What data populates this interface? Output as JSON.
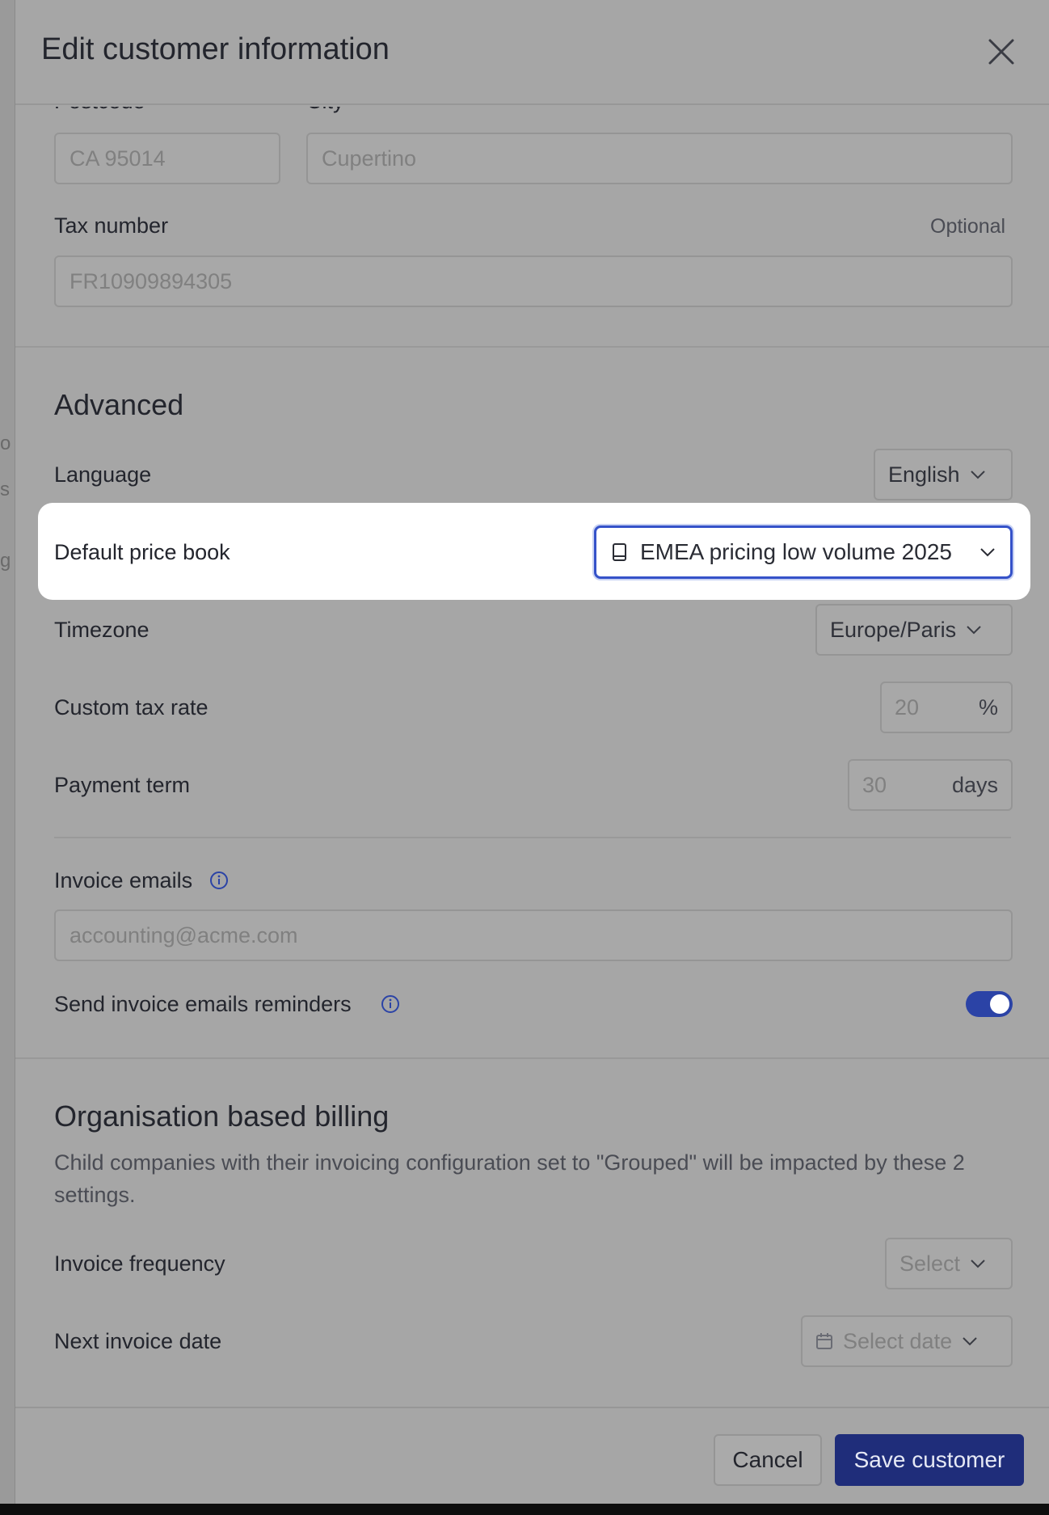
{
  "header": {
    "title": "Edit customer information"
  },
  "address": {
    "postcode_label": "Postcode",
    "city_label": "City",
    "postcode_value": "CA 95014",
    "city_value": "Cupertino"
  },
  "tax": {
    "label": "Tax number",
    "optional": "Optional",
    "value": "FR10909894305"
  },
  "advanced": {
    "title": "Advanced",
    "language_label": "Language",
    "language_value": "English",
    "price_book_label": "Default price book",
    "price_book_value": "EMEA pricing low volume 2025",
    "timezone_label": "Timezone",
    "timezone_value": "Europe/Paris",
    "tax_rate_label": "Custom tax rate",
    "tax_rate_value": "20",
    "tax_rate_suffix": "%",
    "payment_term_label": "Payment term",
    "payment_term_value": "30",
    "payment_term_suffix": "days",
    "invoice_emails_label": "Invoice emails",
    "invoice_emails_placeholder": "accounting@acme.com",
    "reminders_label": "Send invoice emails reminders",
    "reminders_enabled": true
  },
  "org_billing": {
    "title": "Organisation based billing",
    "description": "Child companies with their invoicing configuration set to \"Grouped\" will be impacted by these 2 settings.",
    "frequency_label": "Invoice frequency",
    "frequency_placeholder": "Select",
    "next_date_label": "Next invoice date",
    "next_date_placeholder": "Select date"
  },
  "footer": {
    "cancel_label": "Cancel",
    "save_label": "Save customer"
  },
  "colors": {
    "accent": "#3552c9",
    "primary_button": "#1f2d7a",
    "toggle_on": "#2b43a6"
  }
}
